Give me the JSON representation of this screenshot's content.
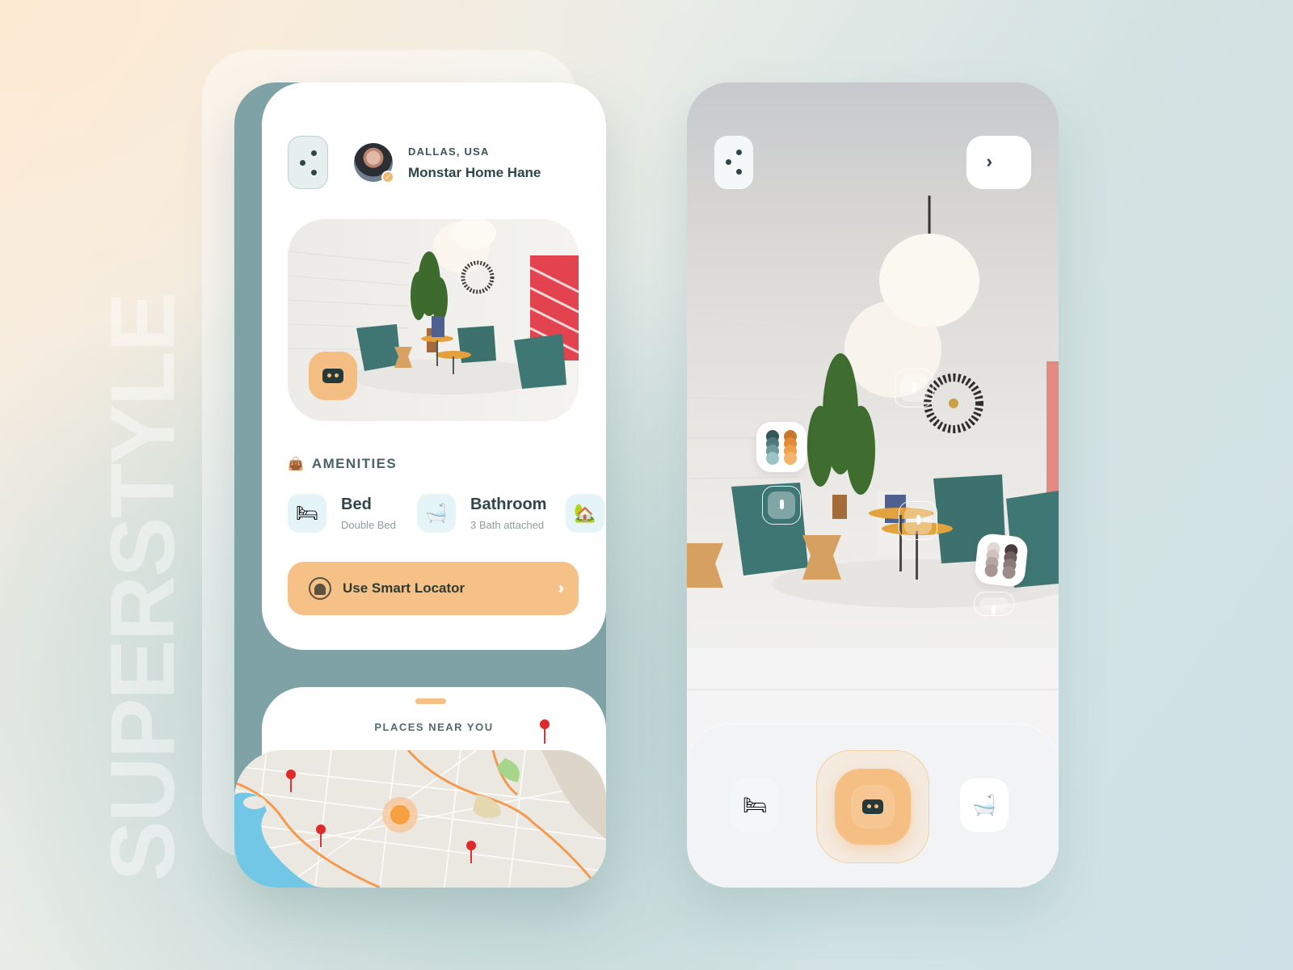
{
  "brand_text": "SUPERSTYLE",
  "colors": {
    "accent": "#f5c186",
    "teal": "#7ea2a5",
    "dark_text": "#2f4649"
  },
  "left_screen": {
    "menu_icon": "three-dot-menu-icon",
    "header": {
      "location_label": "DALLAS, USA",
      "location_name": "Monstar Home Hane",
      "avatar_badge_icon": "check-icon"
    },
    "hero": {
      "image": "living-room-photo",
      "vr_icon": "vr-headset-icon"
    },
    "amenities": {
      "title": "AMENITIES",
      "title_icon": "handbag-icon",
      "items": [
        {
          "icon": "🛏",
          "icon_name": "bed-icon",
          "name": "Bed",
          "detail": "Double Bed"
        },
        {
          "icon": "🛁",
          "icon_name": "bathtub-icon",
          "name": "Bathroom",
          "detail": "3 Bath attached"
        },
        {
          "icon": "🏡",
          "icon_name": "house-icon",
          "name": "",
          "detail": ""
        }
      ]
    },
    "locator_button": {
      "label": "Use Smart Locator",
      "icon": "locator-icon",
      "chevrons": "›››"
    },
    "places": {
      "title": "PLACES NEAR YOU",
      "pins": 4
    }
  },
  "right_screen": {
    "menu_icon": "three-dot-menu-icon",
    "next_button": {
      "icon": "triple-chevron-right-icon",
      "chevrons": "›››"
    },
    "hotspots": 4,
    "palettes": [
      {
        "name": "teal-orange-palette",
        "col1": [
          "#345659",
          "#4f7a7d",
          "#6e9a9c",
          "#9cc4c5"
        ],
        "col2": [
          "#c9762e",
          "#e38a34",
          "#f0a04b",
          "#f5b36b"
        ]
      },
      {
        "name": "neutral-brown-palette",
        "col1": [
          "#e2d8d5",
          "#cfc2bf",
          "#b8a8a4",
          "#a8958f"
        ],
        "col2": [
          "#4a3d3b",
          "#6e605c",
          "#8a7b76",
          "#9c8c87"
        ]
      }
    ],
    "dock": {
      "left_icon": "🛏",
      "left_icon_name": "bed-icon",
      "center_icon": "vr-headset-icon",
      "right_icon": "🛁",
      "right_icon_name": "bathtub-icon"
    }
  }
}
